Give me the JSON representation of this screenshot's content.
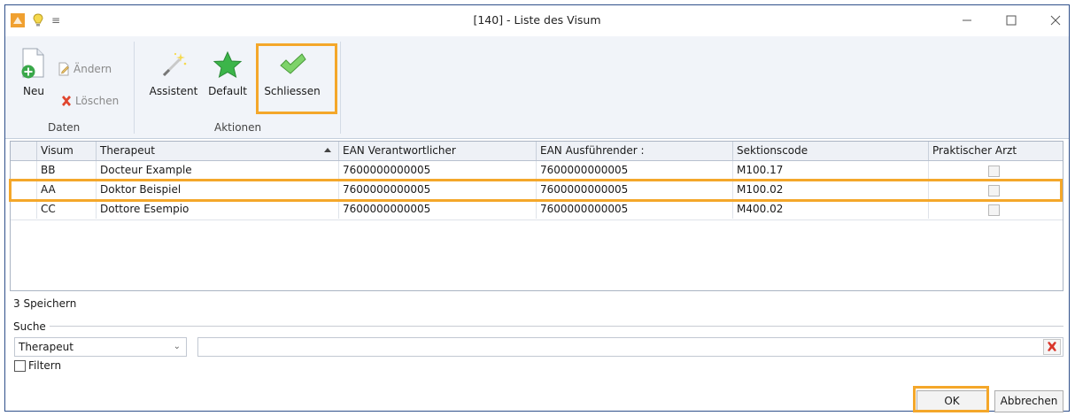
{
  "window": {
    "title": "[140] - Liste des Visum",
    "quick_access": "≡"
  },
  "ribbon": {
    "groups": [
      {
        "label": "Daten"
      },
      {
        "label": "Aktionen"
      }
    ],
    "buttons": {
      "neu": "Neu",
      "aendern": "Ändern",
      "loeschen": "Löschen",
      "assistent": "Assistent",
      "default": "Default",
      "schliessen": "Schliessen"
    }
  },
  "grid": {
    "columns": [
      "Visum",
      "Therapeut",
      "EAN Verantwortlicher",
      "EAN  Ausführender :",
      "Sektionscode",
      "Praktischer Arzt"
    ],
    "rows": [
      {
        "visum": "BB",
        "therapeut": "Docteur Example",
        "ean_v": "7600000000005",
        "ean_a": "7600000000005",
        "code": "M100.17"
      },
      {
        "visum": "AA",
        "therapeut": "Doktor Beispiel",
        "ean_v": "7600000000005",
        "ean_a": "7600000000005",
        "code": "M100.02"
      },
      {
        "visum": "CC",
        "therapeut": "Dottore Esempio",
        "ean_v": "7600000000005",
        "ean_a": "7600000000005",
        "code": "M400.02"
      }
    ]
  },
  "status": "3 Speichern",
  "search": {
    "label": "Suche",
    "field": "Therapeut",
    "value": "",
    "filter_label": "Filtern"
  },
  "footer": {
    "ok": "OK",
    "cancel": "Abbrechen"
  },
  "colors": {
    "highlight": "#f4a72a",
    "ribbon_bg": "#f1f4f9",
    "border": "#2f4f8a"
  }
}
